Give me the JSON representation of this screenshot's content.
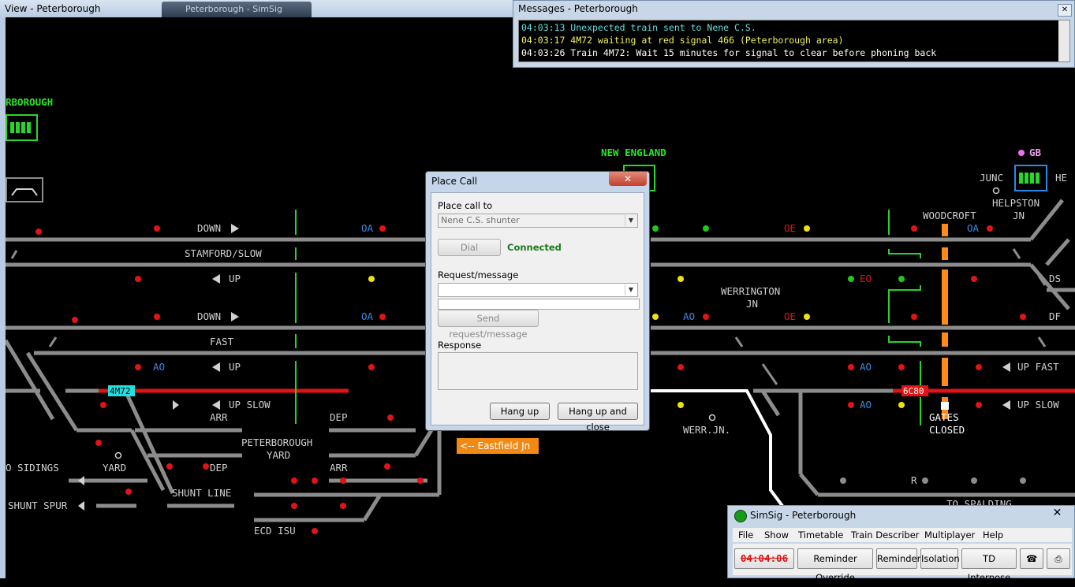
{
  "view": {
    "title": "View - Peterborough",
    "tab_title": "Peterborough - SimSig"
  },
  "messages": {
    "title": "Messages - Peterborough",
    "close_glyph": "✕",
    "lines": [
      {
        "text": "04:03:13 Unexpected train sent to Nene C.S.",
        "color": "#5de0e0"
      },
      {
        "text": "04:03:17 4M72 waiting at red signal 466 (Peterborough area)",
        "color": "#f0f060"
      },
      {
        "text": "04:03:26 Train 4M72: Wait 15 minutes for signal to clear before phoning back",
        "color": "#ffffff"
      }
    ]
  },
  "map": {
    "labels": {
      "peterborough": "RBOROUGH",
      "new_england": "NEW ENGLAND",
      "gb": "GB",
      "junc": "JUNC",
      "he": "HE",
      "helpston": "HELPSTON",
      "helpston_jn": "JN",
      "woodcroft": "WOODCROFT",
      "down1": "DOWN",
      "stamford_slow": "STAMFORD/SLOW",
      "up1": "UP",
      "down2": "DOWN",
      "fast": "FAST",
      "up2": "UP",
      "up_slow": "UP SLOW",
      "werrington": "WERRINGTON",
      "werrington_jn": "JN",
      "ds": "DS",
      "df": "DF",
      "up_fast_right": "UP FAST",
      "up_slow_right": "UP SLOW",
      "arr1": "ARR",
      "dep1": "DEP",
      "peterborough_yard_1": "PETERBOROUGH",
      "peterborough_yard_2": "YARD",
      "dep2": "DEP",
      "arr2": "ARR",
      "sidings": "O SIDINGS",
      "yard": "YARD",
      "shunt_spur": "SHUNT SPUR",
      "shunt_line": "SHUNT LINE",
      "ecd_isu": "ECD ISU",
      "werr_jn": "WERR.JN.",
      "gates_closed_1": "GATES",
      "gates_closed_2": "CLOSED",
      "r_label": "R",
      "to_spalding": "TO SPALDING",
      "eastfield": "<-- Eastfield Jn",
      "train_4m72": "4M72",
      "train_6c80": "6C80",
      "ao_1": "AO",
      "oa_1": "OA",
      "oa_2": "OA",
      "ao_2": "AO",
      "oa_3": "OA",
      "oe_1": "OE",
      "oe_2": "OE",
      "eo": "EO",
      "ao_3": "AO",
      "ao_4": "AO"
    }
  },
  "dialog": {
    "title": "Place Call",
    "close_glyph": "✕",
    "place_call_to_label": "Place call to",
    "place_call_to_value": "Nene C.S. shunter",
    "dial_label": "Dial",
    "status": "Connected",
    "request_label": "Request/message",
    "send_label": "Send request/message",
    "response_label": "Response",
    "hang_up_label": "Hang up",
    "hang_up_close_label": "Hang up and close"
  },
  "simsig": {
    "title": "SimSig - Peterborough",
    "close_glyph": "✕",
    "menu": [
      "File",
      "Show",
      "Timetable",
      "Train Describer",
      "Multiplayer",
      "Help"
    ],
    "clock": "04:04:06",
    "buttons": {
      "reminder_override": "Reminder Override",
      "reminder": "Reminder",
      "isolation": "Isolation",
      "td_interpose": "TD Interpose"
    }
  }
}
